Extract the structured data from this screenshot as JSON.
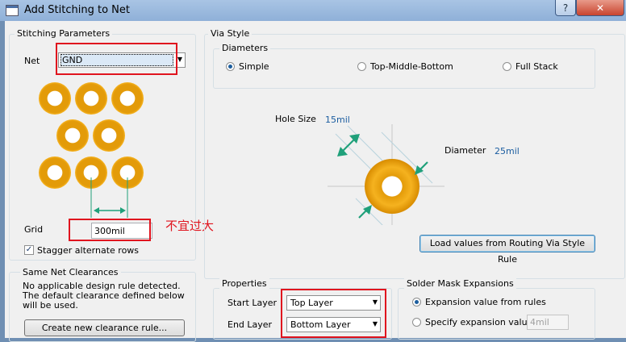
{
  "window": {
    "title": "Add Stitching to Net",
    "help_glyph": "?",
    "close_glyph": "✕"
  },
  "stitching": {
    "group_title": "Stitching Parameters",
    "net_label": "Net",
    "net_value": "GND",
    "grid_label": "Grid",
    "grid_value": "300mil",
    "annotation": "不宜过大",
    "stagger_label": "Stagger alternate rows",
    "stagger_checked": true
  },
  "clearances": {
    "group_title": "Same Net Clearances",
    "message": "No applicable design rule detected. The default clearance defined below will be used.",
    "create_button": "Create new clearance rule..."
  },
  "via_style": {
    "group_title": "Via Style",
    "diameters_title": "Diameters",
    "options": [
      {
        "label": "Simple",
        "selected": true
      },
      {
        "label": "Top-Middle-Bottom",
        "selected": false
      },
      {
        "label": "Full Stack",
        "selected": false
      }
    ],
    "hole_size_label": "Hole Size",
    "hole_size_value": "15mil",
    "diameter_label": "Diameter",
    "diameter_value": "25mil",
    "load_button": "Load values from Routing Via Style Rule"
  },
  "properties": {
    "group_title": "Properties",
    "start_label": "Start Layer",
    "start_value": "Top Layer",
    "end_label": "End Layer",
    "end_value": "Bottom Layer"
  },
  "solder_mask": {
    "group_title": "Solder Mask Expansions",
    "option1": "Expansion value from rules",
    "option1_selected": true,
    "option2": "Specify expansion value",
    "option2_selected": false,
    "value_placeholder": "4mil"
  },
  "colors": {
    "accent_red": "#e0141e",
    "pad_orange": "#f5b21f",
    "arrow_green": "#1fa07a",
    "value_blue": "#1b5da0"
  }
}
